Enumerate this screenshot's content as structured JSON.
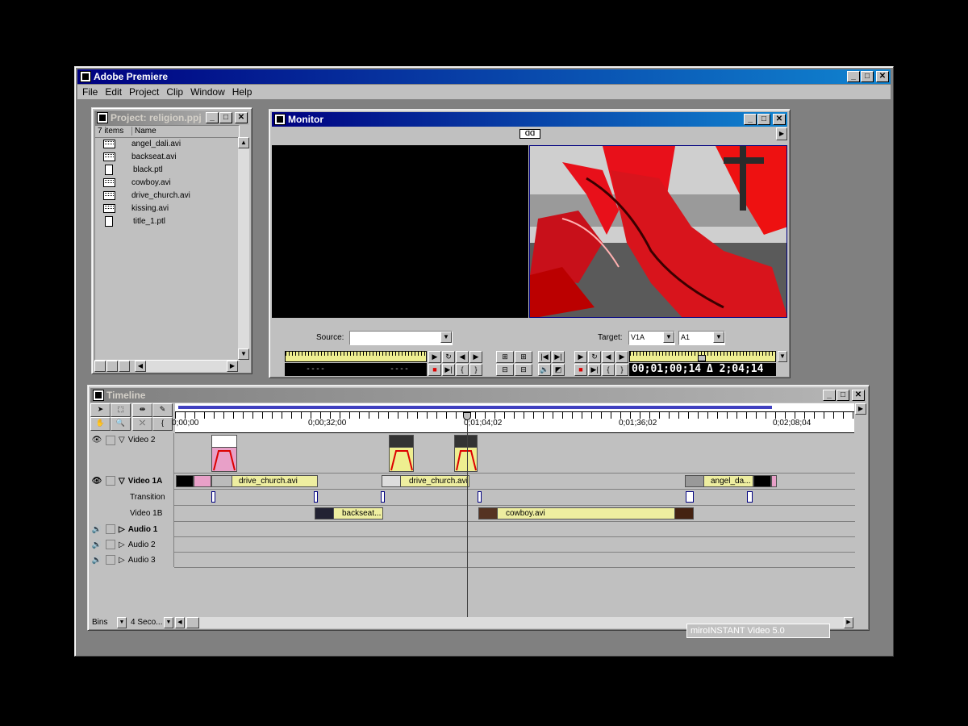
{
  "app": {
    "title": "Adobe Premiere",
    "menu": [
      "File",
      "Edit",
      "Project",
      "Clip",
      "Window",
      "Help"
    ]
  },
  "project": {
    "title": "Project: religion.ppj",
    "count": "7 items",
    "column": "Name",
    "files": [
      {
        "name": "angel_dali.avi",
        "icon": "film-icon"
      },
      {
        "name": "backseat.avi",
        "icon": "film-icon"
      },
      {
        "name": "black.ptl",
        "icon": "document-icon"
      },
      {
        "name": "cowboy.avi",
        "icon": "film-icon"
      },
      {
        "name": "drive_church.avi",
        "icon": "film-icon"
      },
      {
        "name": "kissing.avi",
        "icon": "film-icon"
      },
      {
        "name": "title_1.ptl",
        "icon": "document-icon"
      }
    ]
  },
  "monitor": {
    "title": "Monitor",
    "source_label": "Source:",
    "target_label": "Target:",
    "target_video": "V1A",
    "target_audio": "A1",
    "source_timecode_in": "----",
    "source_timecode_out": "----",
    "program_timecode": "00;01;00;14",
    "program_duration": "Δ 2;04;14",
    "top_badge": "ᗡᗡ"
  },
  "timeline": {
    "title": "Timeline",
    "ruler": [
      "0;00;00",
      "0;00;32;00",
      "0;01;04;02",
      "0;01;36;02",
      "0;02;08;04"
    ],
    "tracks": {
      "video2": "Video 2",
      "video1a": "Video 1A",
      "transition": "Transition",
      "video1b": "Video 1B",
      "audio1": "Audio 1",
      "audio2": "Audio 2",
      "audio3": "Audio 3"
    },
    "clips": {
      "v1a_1": "drive_church.avi",
      "v1a_2": "drive_church.avi",
      "v1a_3": "angel_da...",
      "v1b_1": "backseat...",
      "v1b_2": "cowboy.avi"
    },
    "bins_label": "Bins",
    "zoom_label": "4 Seco...",
    "status_overlay": "miroINSTANT Video 5.0"
  },
  "colors": {
    "active_title": "#000080",
    "inactive_title": "#808080",
    "clip_fill": "#eeeea0",
    "pink": "#e8a0c8",
    "timecode_bg": "#000000"
  }
}
